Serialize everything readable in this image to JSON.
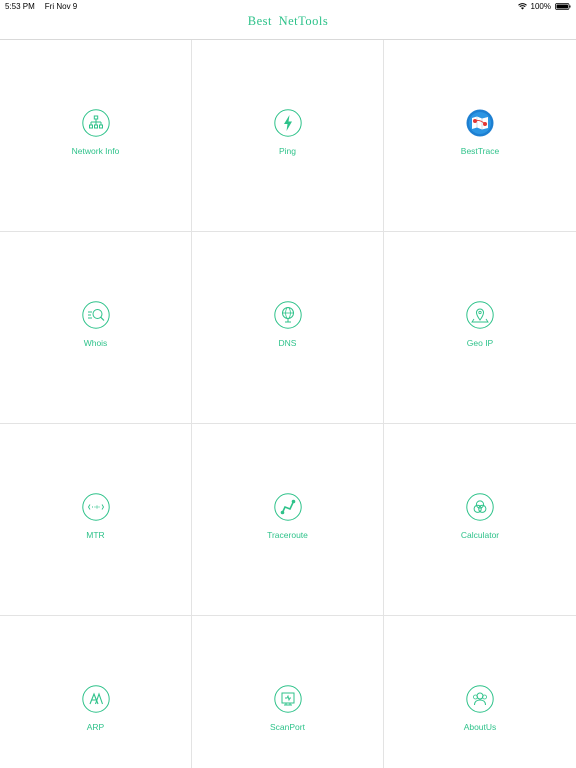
{
  "status_bar": {
    "time": "5:53 PM",
    "date": "Fri Nov 9",
    "battery": "100%"
  },
  "nav": {
    "title": "Best  NetTools"
  },
  "colors": {
    "accent": "#2ec28a",
    "divider": "#e3e3e3"
  },
  "tools": [
    {
      "label": "Network Info",
      "icon": "network-tree-icon"
    },
    {
      "label": "Ping",
      "icon": "lightning-icon"
    },
    {
      "label": "BestTrace",
      "icon": "besttrace-map-icon"
    },
    {
      "label": "Whois",
      "icon": "magnifier-list-icon"
    },
    {
      "label": "DNS",
      "icon": "globe-pin-icon"
    },
    {
      "label": "Geo IP",
      "icon": "map-pin-icon"
    },
    {
      "label": "MTR",
      "icon": "code-brackets-icon"
    },
    {
      "label": "Traceroute",
      "icon": "route-path-icon"
    },
    {
      "label": "Calculator",
      "icon": "overlap-circles-icon"
    },
    {
      "label": "ARP",
      "icon": "arp-icon"
    },
    {
      "label": "ScanPort",
      "icon": "monitor-scan-icon"
    },
    {
      "label": "AboutUs",
      "icon": "people-icon"
    }
  ]
}
